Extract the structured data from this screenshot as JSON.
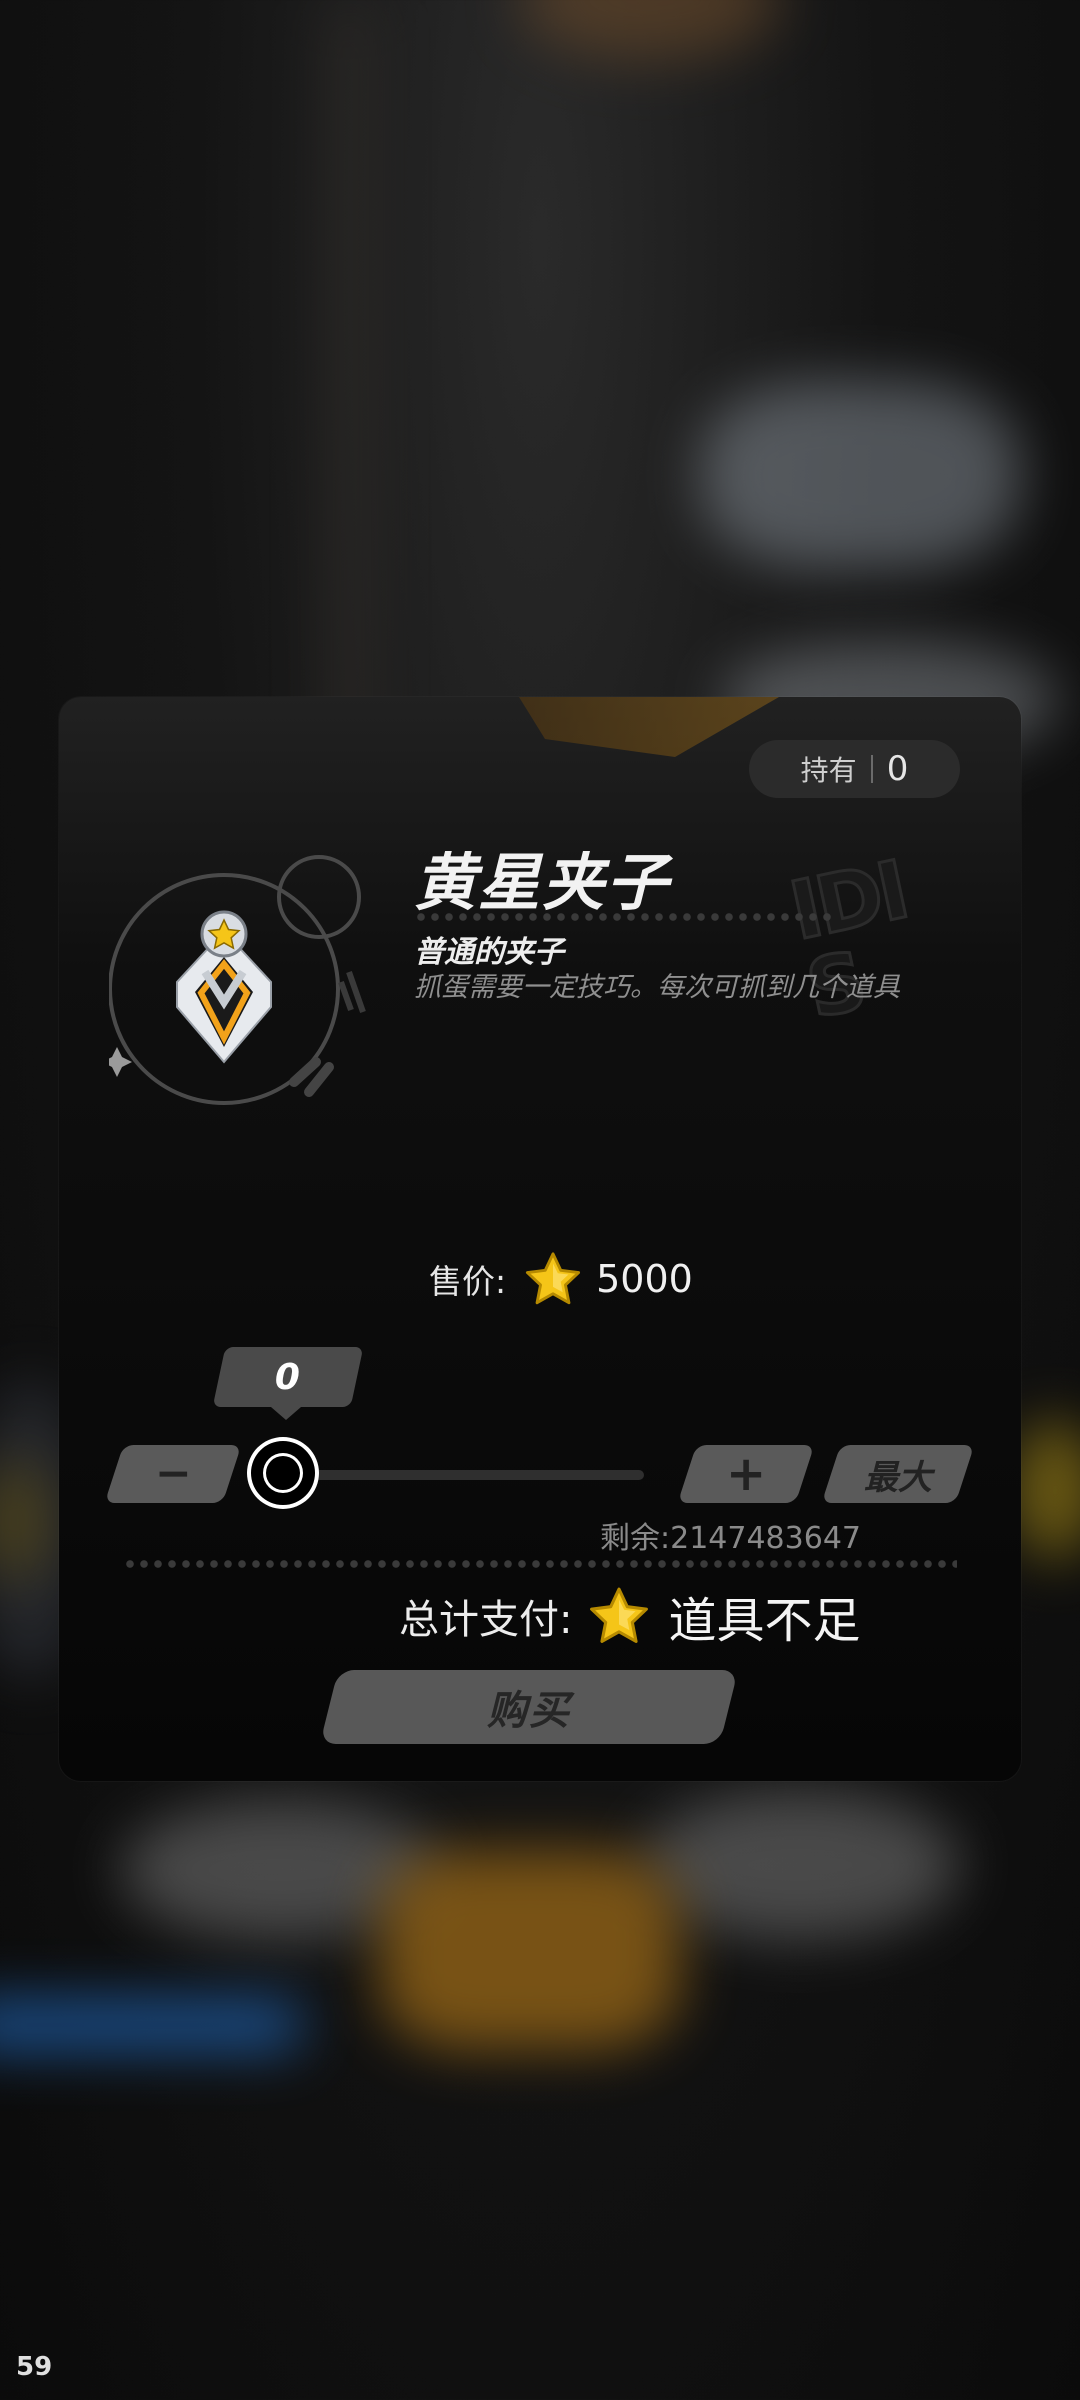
{
  "hold": {
    "label": "持有",
    "value": "0"
  },
  "item": {
    "name": "黄星夹子",
    "subtitle": "普通的夹子",
    "description": "抓蛋需要一定技巧。每次可抓到几个道具"
  },
  "price": {
    "label": "售价:",
    "currency_icon": "yellow-star-icon",
    "value": "5000"
  },
  "quantity": {
    "selected": "0",
    "minus_label": "−",
    "plus_label": "+",
    "max_label": "最大",
    "slider_level": 0
  },
  "remaining": "剩余:2147483647",
  "total": {
    "label": "总计支付:",
    "currency_icon": "yellow-star-icon",
    "value": "道具不足"
  },
  "buy_label": "购买",
  "fps": "59",
  "colors": {
    "panel_bg": "#0a0a0a",
    "button_gray": "#585858",
    "star_yellow": "#f5c518",
    "emblem_orange": "#f2a21a"
  }
}
